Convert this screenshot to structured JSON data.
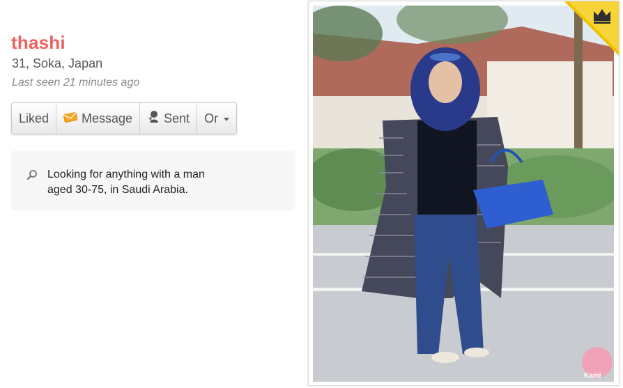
{
  "profile": {
    "name": "thashi",
    "location": "31, Soka, Japan",
    "last_seen": "Last seen 21 minutes ago"
  },
  "actions": {
    "liked": "Liked",
    "message": "Message",
    "sent": "Sent",
    "or": "Or"
  },
  "looking_for": {
    "icon": "search-icon",
    "text": "Looking for anything with a man aged 30-75, in Saudi Arabia."
  },
  "photo": {
    "badge_icon": "crown-icon",
    "watermark": "Kami"
  },
  "colors": {
    "name": "#f0605f",
    "badge": "#f2c200"
  }
}
